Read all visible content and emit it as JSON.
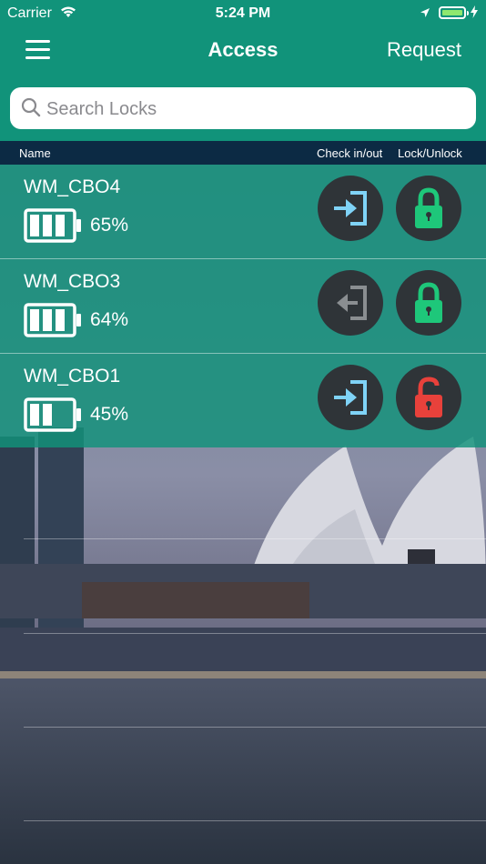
{
  "status_bar": {
    "carrier": "Carrier",
    "time": "5:24 PM"
  },
  "nav": {
    "title": "Access",
    "request_label": "Request"
  },
  "search": {
    "placeholder": "Search Locks",
    "value": ""
  },
  "columns": {
    "name": "Name",
    "check": "Check in/out",
    "lock": "Lock/Unlock"
  },
  "locks": [
    {
      "name": "WM_CBO4",
      "battery_pct": "65%",
      "battery_bars": 3,
      "checkin_state": "active",
      "lock_state": "locked"
    },
    {
      "name": "WM_CBO3",
      "battery_pct": "64%",
      "battery_bars": 3,
      "checkin_state": "inactive",
      "lock_state": "locked"
    },
    {
      "name": "WM_CBO1",
      "battery_pct": "45%",
      "battery_bars": 2,
      "checkin_state": "active",
      "lock_state": "unlocked"
    }
  ],
  "colors": {
    "header": "#11937a",
    "checkin_active": "#7fd3f7",
    "checkin_inactive": "#8a8e91",
    "locked": "#1ec77a",
    "unlocked": "#e8413b"
  },
  "icons": {
    "menu": "hamburger-icon",
    "search": "magnifier-icon",
    "checkin": "sign-in-arrow-icon",
    "lock": "padlock-icon"
  }
}
